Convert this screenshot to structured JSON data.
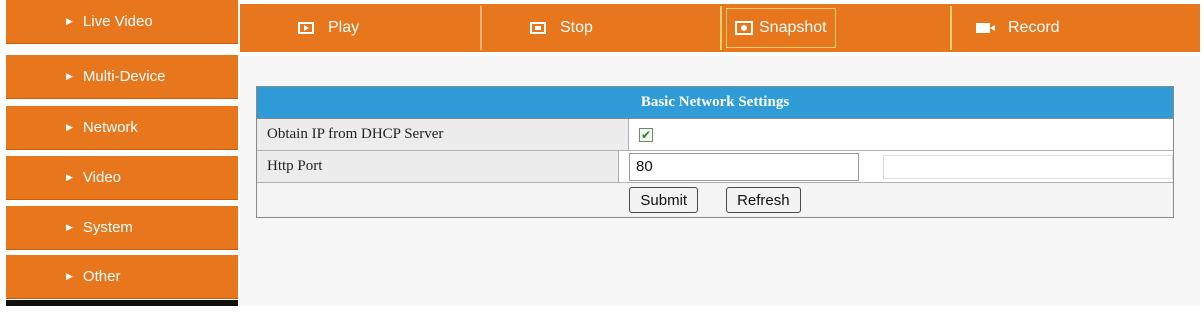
{
  "sidebar": {
    "items": [
      {
        "label": "Live Video"
      },
      {
        "label": "Multi-Device"
      },
      {
        "label": "Network"
      },
      {
        "label": "Video"
      },
      {
        "label": "System"
      },
      {
        "label": "Other"
      }
    ]
  },
  "toolbar": {
    "play_label": "Play",
    "stop_label": "Stop",
    "snapshot_label": "Snapshot",
    "record_label": "Record"
  },
  "settings": {
    "title": "Basic Network Settings",
    "dhcp_label": "Obtain IP from DHCP Server",
    "dhcp_checked": true,
    "http_port_label": "Http Port",
    "http_port_value": "80",
    "submit_label": "Submit",
    "refresh_label": "Refresh"
  },
  "colors": {
    "accent": "#e8761c",
    "header_blue": "#2f9bd7"
  }
}
